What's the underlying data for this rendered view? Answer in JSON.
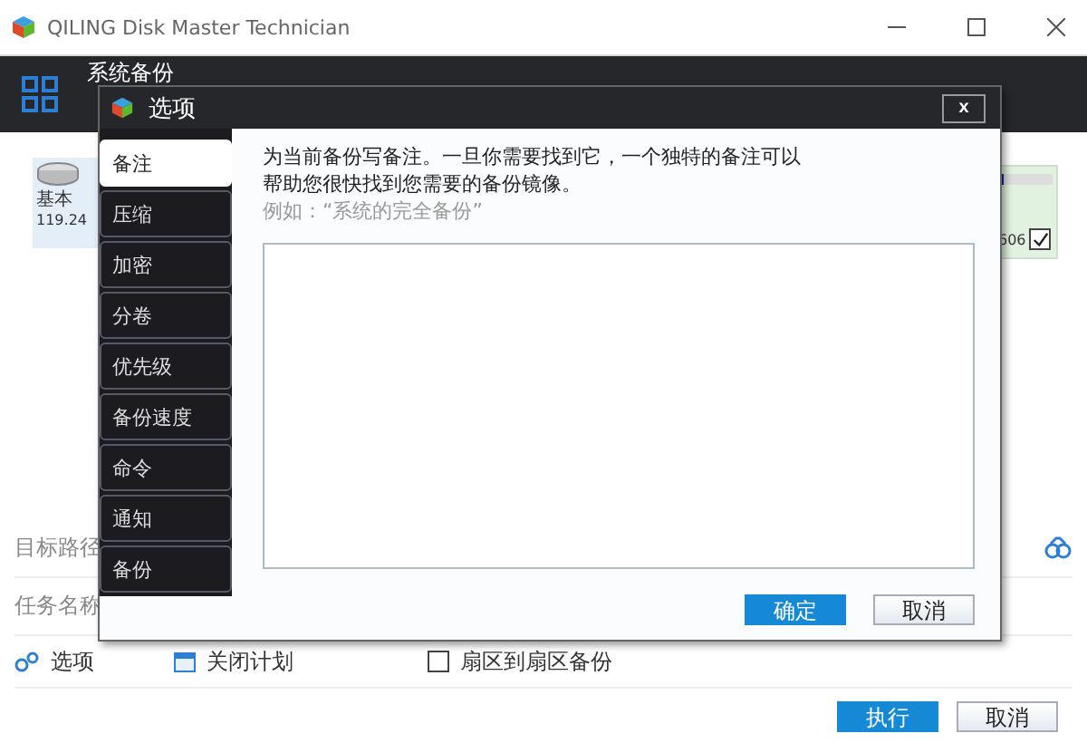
{
  "window": {
    "title": "QILING Disk Master Technician"
  },
  "header": {
    "title": "系统备份"
  },
  "disk": {
    "label": "基本",
    "size": "119.24",
    "right_text": "606",
    "level": 0.1,
    "checked": true
  },
  "rows": [
    {
      "label": "目标路径"
    },
    {
      "label": "任务名称"
    }
  ],
  "options_bar": [
    {
      "kind": "options",
      "label": "选项"
    },
    {
      "kind": "schedule",
      "label": "关闭计划"
    },
    {
      "kind": "checkbox",
      "label": "扇区到扇区备份",
      "checked": false
    }
  ],
  "buttons": [
    {
      "label": "执行",
      "primary": true
    },
    {
      "label": "取消",
      "primary": false
    }
  ],
  "dialog": {
    "title": "选项",
    "close": "x",
    "nav": [
      {
        "label": "备注",
        "selected": true
      },
      {
        "label": "压缩",
        "selected": false
      },
      {
        "label": "加密",
        "selected": false
      },
      {
        "label": "分卷",
        "selected": false
      },
      {
        "label": "优先级",
        "selected": false
      },
      {
        "label": "备份速度",
        "selected": false
      },
      {
        "label": "命令",
        "selected": false
      },
      {
        "label": "通知",
        "selected": false
      },
      {
        "label": "备份",
        "selected": false
      }
    ],
    "description": "为当前备份写备注。一旦你需要找到它，一个独特的备注可以帮助您很快找到您需要的备份镜像。",
    "example": "例如：“系统的完全备份”",
    "buttons": [
      {
        "label": "确定",
        "primary": true
      },
      {
        "label": "取消",
        "primary": false
      }
    ]
  }
}
